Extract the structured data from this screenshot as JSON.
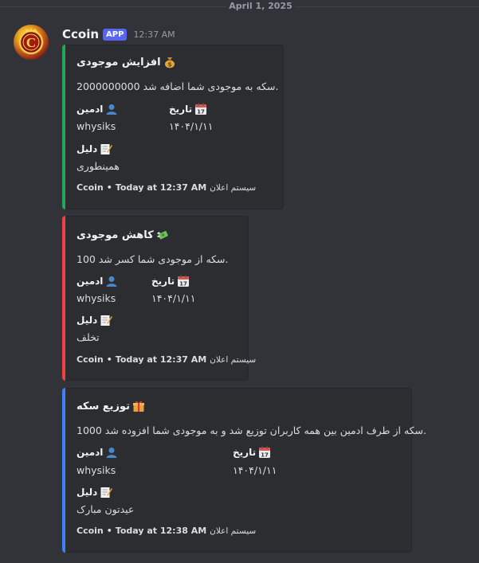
{
  "date_divider": "April 1, 2025",
  "message": {
    "username": "Ccoin",
    "badge": "APP",
    "timestamp": "12:37 AM",
    "avatar_letter": "C"
  },
  "embeds": [
    {
      "color": "#23a55a",
      "title": "افزایش موجودی",
      "title_icon": "money-bag-icon",
      "description": "2000000000 سکه به موجودی شما اضافه شد.",
      "fields": [
        {
          "name": "ادمین",
          "icon": "bust-icon",
          "value": "whysiks"
        },
        {
          "name": "تاریخ",
          "icon": "calendar-icon",
          "value": "۱۴۰۴/۱/۱۱"
        },
        {
          "name": "دلیل",
          "icon": "memo-icon",
          "value": "همینطوری"
        }
      ],
      "footer": {
        "author": "Ccoin",
        "time": "Today at 12:37 AM",
        "system": "سیستم اعلان"
      }
    },
    {
      "color": "#f23f43",
      "title": "کاهش موجودی",
      "title_icon": "money-with-wings-icon",
      "description": "100 سکه از موجودی شما کسر شد.",
      "fields": [
        {
          "name": "ادمین",
          "icon": "bust-icon",
          "value": "whysiks"
        },
        {
          "name": "تاریخ",
          "icon": "calendar-icon",
          "value": "۱۴۰۴/۱/۱۱"
        },
        {
          "name": "دلیل",
          "icon": "memo-icon",
          "value": "تخلف"
        }
      ],
      "footer": {
        "author": "Ccoin",
        "time": "Today at 12:37 AM",
        "system": "سیستم اعلان"
      }
    },
    {
      "color": "#3b82f6",
      "title": "توزیع سکه",
      "title_icon": "gift-icon",
      "description": "1000 سکه از طرف ادمین بین همه کاربران توزیع شد و به موجودی شما افزوده شد.",
      "fields": [
        {
          "name": "ادمین",
          "icon": "bust-icon",
          "value": "whysiks"
        },
        {
          "name": "تاریخ",
          "icon": "calendar-icon",
          "value": "۱۴۰۴/۱/۱۱"
        },
        {
          "name": "دلیل",
          "icon": "memo-icon",
          "value": "عیدتون مبارک"
        }
      ],
      "footer": {
        "author": "Ccoin",
        "time": "Today at 12:38 AM",
        "system": "سیستم اعلان"
      }
    }
  ]
}
